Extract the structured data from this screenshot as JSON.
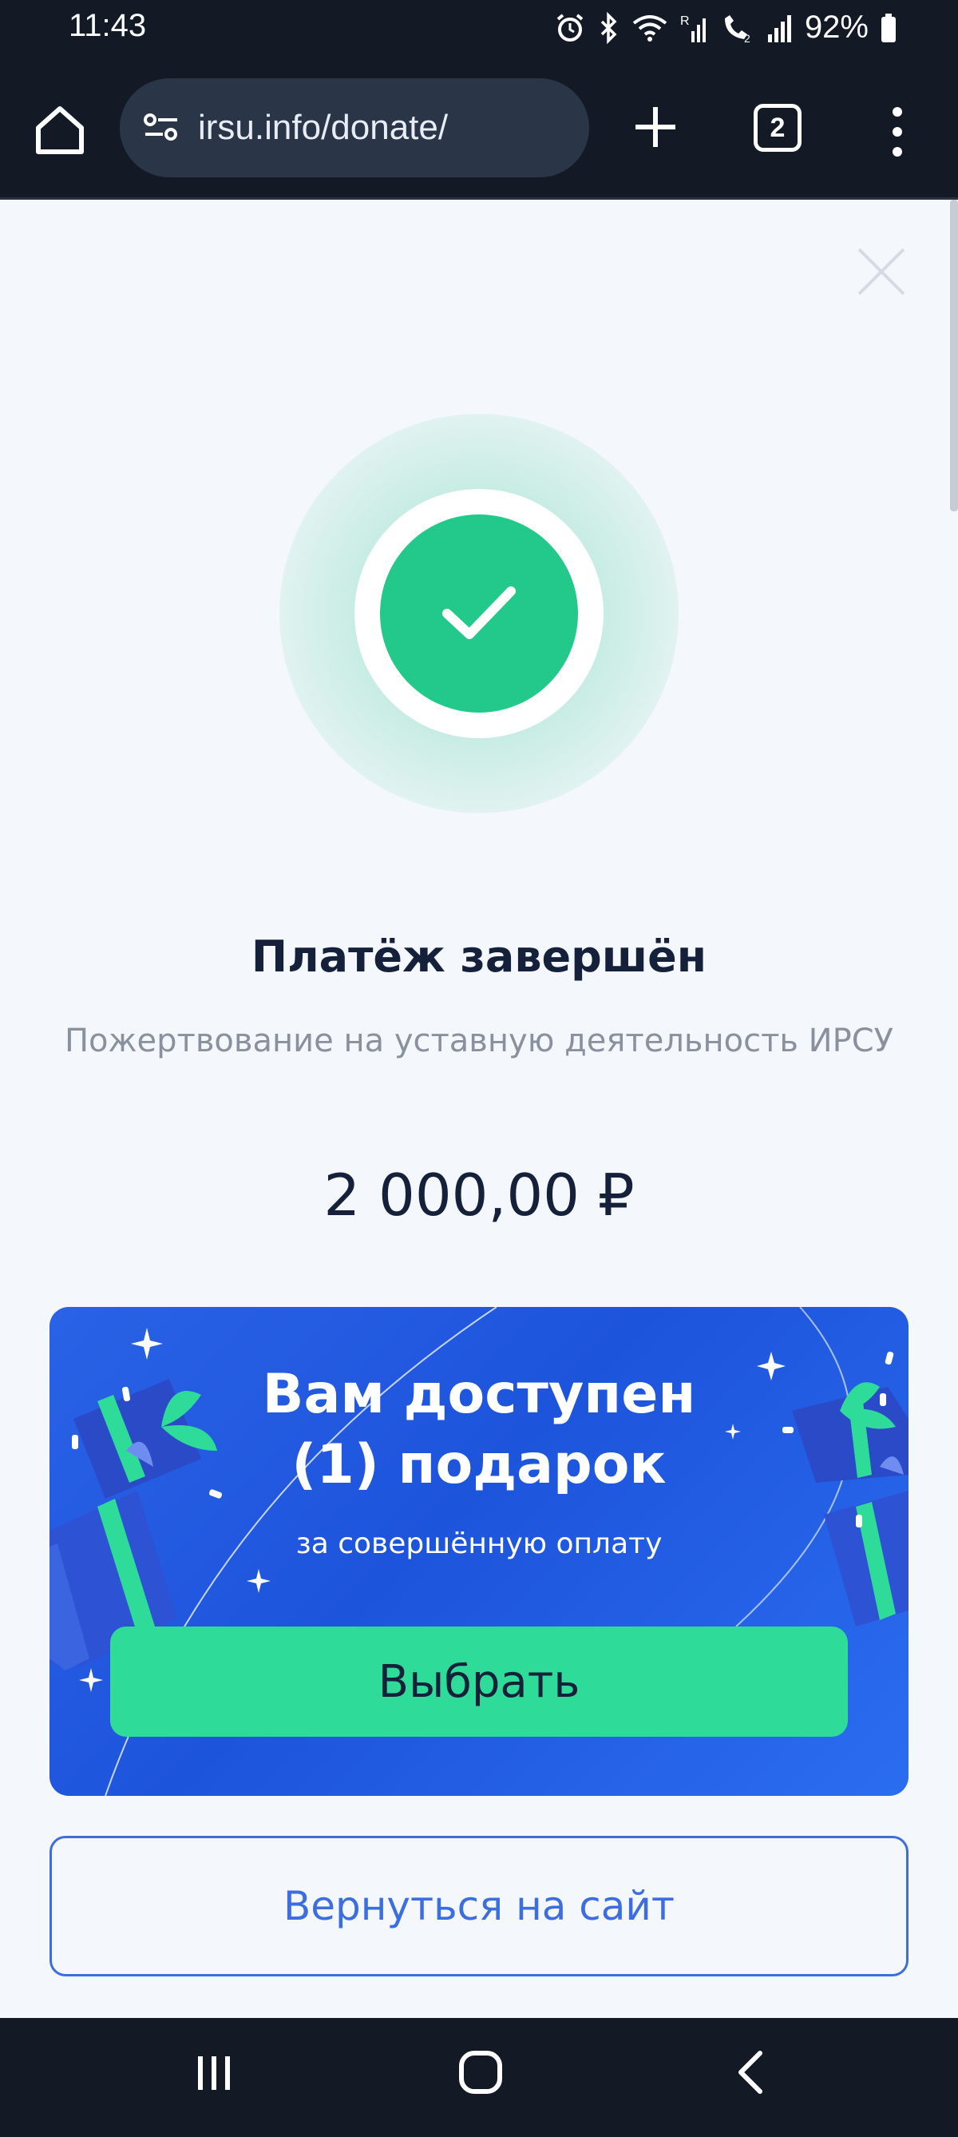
{
  "status_bar": {
    "time": "11:43",
    "battery": "92%",
    "icons": [
      "alarm-icon",
      "bluetooth-icon",
      "wifi-icon",
      "signal-r-icon",
      "wifi-calling-icon",
      "cell-signal-icon",
      "battery-icon"
    ]
  },
  "browser": {
    "url": "irsu.info/donate/",
    "tab_count": "2",
    "icons": [
      "home-icon",
      "site-settings-icon",
      "new-tab-icon",
      "tabs-icon",
      "more-menu-icon"
    ]
  },
  "payment": {
    "title": "Платёж завершён",
    "description": "Пожертвование на уставную деятельность ИРСУ",
    "amount": "2 000,00 ₽",
    "success_color": "#23c98a"
  },
  "gift": {
    "title_line1": "Вам доступен",
    "title_line2": "(1) подарок",
    "subtitle": "за совершённую оплату",
    "button_label": "Выбрать",
    "card_color": "#2a62e6",
    "button_color": "#2edb98"
  },
  "back_button_label": "Вернуться на сайт",
  "nav_bar": {
    "icons": [
      "recent-apps-icon",
      "home-nav-icon",
      "back-nav-icon"
    ]
  }
}
